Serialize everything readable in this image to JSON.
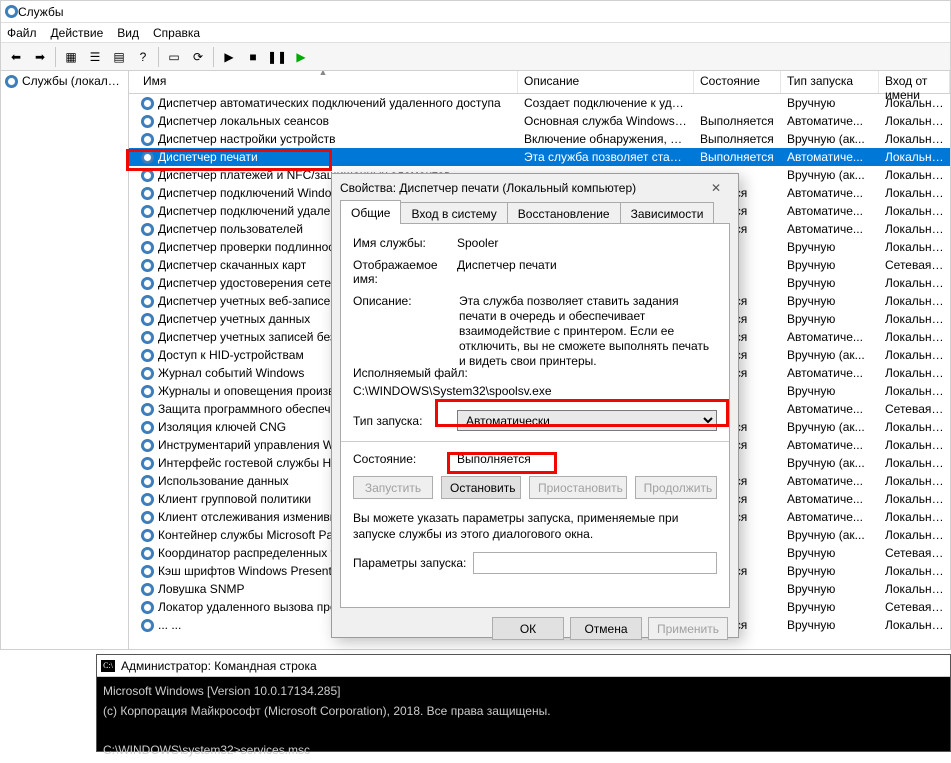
{
  "window": {
    "title": "Службы",
    "menu": {
      "file": "Файл",
      "action": "Действие",
      "view": "Вид",
      "help": "Справка"
    },
    "tree_root": "Службы (локальные)"
  },
  "columns": {
    "name": "Имя",
    "desc": "Описание",
    "state": "Состояние",
    "start": "Тип запуска",
    "logon": "Вход от имени"
  },
  "services": [
    {
      "name": "Диспетчер автоматических подключений удаленного доступа",
      "desc": "Создает подключение к уда...",
      "state": "",
      "start": "Вручную",
      "logon": "Локальная система"
    },
    {
      "name": "Диспетчер локальных сеансов",
      "desc": "Основная служба Windows, ...",
      "state": "Выполняется",
      "start": "Автоматиче...",
      "logon": "Локальная система"
    },
    {
      "name": "Диспетчер настройки устройств",
      "desc": "Включение обнаружения, ск...",
      "state": "Выполняется",
      "start": "Вручную (ак...",
      "logon": "Локальная система"
    },
    {
      "name": "Диспетчер печати",
      "desc": "Эта служба позволяет стави...",
      "state": "Выполняется",
      "start": "Автоматиче...",
      "logon": "Локальная система",
      "selected": true
    },
    {
      "name": "Диспетчер платежей и NFC/защищенных элементов",
      "desc": "",
      "state": "",
      "start": "Вручную (ак...",
      "logon": "Локальная система"
    },
    {
      "name": "Диспетчер подключений Windows",
      "desc": "",
      "state": "...няется",
      "start": "Автоматиче...",
      "logon": "Локальная система"
    },
    {
      "name": "Диспетчер подключений удаленного доступа",
      "desc": "",
      "state": "...няется",
      "start": "Автоматиче...",
      "logon": "Локальная система"
    },
    {
      "name": "Диспетчер пользователей",
      "desc": "",
      "state": "...няется",
      "start": "Автоматиче...",
      "logon": "Локальная система"
    },
    {
      "name": "Диспетчер проверки подлинности Xbox Live",
      "desc": "",
      "state": "",
      "start": "Вручную",
      "logon": "Локальная система"
    },
    {
      "name": "Диспетчер скачанных карт",
      "desc": "",
      "state": "",
      "start": "Вручную",
      "logon": "Сетевая служба"
    },
    {
      "name": "Диспетчер удостоверения сетевых участников",
      "desc": "",
      "state": "",
      "start": "Вручную",
      "logon": "Локальная система"
    },
    {
      "name": "Диспетчер учетных веб-записей",
      "desc": "",
      "state": "...няется",
      "start": "Вручную",
      "logon": "Локальная система"
    },
    {
      "name": "Диспетчер учетных данных",
      "desc": "",
      "state": "...няется",
      "start": "Вручную",
      "logon": "Локальная система"
    },
    {
      "name": "Диспетчер учетных записей безопасности",
      "desc": "",
      "state": "...няется",
      "start": "Автоматиче...",
      "logon": "Локальная система"
    },
    {
      "name": "Доступ к HID-устройствам",
      "desc": "",
      "state": "...няется",
      "start": "Вручную (ак...",
      "logon": "Локальная система"
    },
    {
      "name": "Журнал событий Windows",
      "desc": "",
      "state": "...няется",
      "start": "Автоматиче...",
      "logon": "Локальная система"
    },
    {
      "name": "Журналы и оповещения производительности",
      "desc": "",
      "state": "",
      "start": "Вручную",
      "logon": "Локальная система"
    },
    {
      "name": "Защита программного обеспечения",
      "desc": "",
      "state": "",
      "start": "Автоматиче...",
      "logon": "Сетевая служба"
    },
    {
      "name": "Изоляция ключей CNG",
      "desc": "",
      "state": "...няется",
      "start": "Вручную (ак...",
      "logon": "Локальная система"
    },
    {
      "name": "Инструментарий управления Windows",
      "desc": "",
      "state": "...няется",
      "start": "Автоматиче...",
      "logon": "Локальная система"
    },
    {
      "name": "Интерфейс гостевой службы Hyper-V",
      "desc": "",
      "state": "",
      "start": "Вручную (ак...",
      "logon": "Локальная система"
    },
    {
      "name": "Использование данных",
      "desc": "",
      "state": "...няется",
      "start": "Автоматиче...",
      "logon": "Локальная система"
    },
    {
      "name": "Клиент групповой политики",
      "desc": "",
      "state": "...няется",
      "start": "Автоматиче...",
      "logon": "Локальная система"
    },
    {
      "name": "Клиент отслеживания изменившихся связей",
      "desc": "",
      "state": "...няется",
      "start": "Автоматиче...",
      "logon": "Локальная система"
    },
    {
      "name": "Контейнер службы Microsoft Passport",
      "desc": "",
      "state": "",
      "start": "Вручную (ак...",
      "logon": "Локальная система"
    },
    {
      "name": "Координатор распределенных транзакций",
      "desc": "",
      "state": "",
      "start": "Вручную",
      "logon": "Сетевая служба"
    },
    {
      "name": "Кэш шрифтов Windows Presentation Foundation",
      "desc": "",
      "state": "...няется",
      "start": "Вручную",
      "logon": "Локальная система"
    },
    {
      "name": "Ловушка SNMP",
      "desc": "",
      "state": "",
      "start": "Вручную",
      "logon": "Локальная система"
    },
    {
      "name": "Локатор удаленного вызова процедур (RPC)",
      "desc": "",
      "state": "",
      "start": "Вручную",
      "logon": "Сетевая служба"
    },
    {
      "name": "... ...",
      "desc": "",
      "state": "...няется",
      "start": "Вручную",
      "logon": "Локальная система"
    }
  ],
  "dialog": {
    "title": "Свойства: Диспетчер печати (Локальный компьютер)",
    "tabs": {
      "general": "Общие",
      "logon": "Вход в систему",
      "recovery": "Восстановление",
      "deps": "Зависимости"
    },
    "labels": {
      "service_name": "Имя службы:",
      "display_name": "Отображаемое имя:",
      "description": "Описание:",
      "exe_path": "Исполняемый файл:",
      "startup_type": "Тип запуска:",
      "state": "Состояние:",
      "hint": "Вы можете указать параметры запуска, применяемые при запуске службы из этого диалогового окна.",
      "params": "Параметры запуска:"
    },
    "values": {
      "service_name": "Spooler",
      "display_name": "Диспетчер печати",
      "description": "Эта служба позволяет ставить задания печати в очередь и обеспечивает взаимодействие с принтером. Если ее отключить, вы не сможете выполнять печать и видеть свои принтеры.",
      "exe_path": "C:\\WINDOWS\\System32\\spoolsv.exe",
      "startup_type": "Автоматически",
      "state": "Выполняется"
    },
    "buttons": {
      "start": "Запустить",
      "stop": "Остановить",
      "pause": "Приостановить",
      "resume": "Продолжить",
      "ok": "ОК",
      "cancel": "Отмена",
      "apply": "Применить"
    }
  },
  "console": {
    "title": "Администратор: Командная строка",
    "line1": "Microsoft Windows [Version 10.0.17134.285]",
    "line2": "(c) Корпорация Майкрософт (Microsoft Corporation), 2018. Все права защищены.",
    "prompt": "C:\\WINDOWS\\system32>services.msc"
  }
}
